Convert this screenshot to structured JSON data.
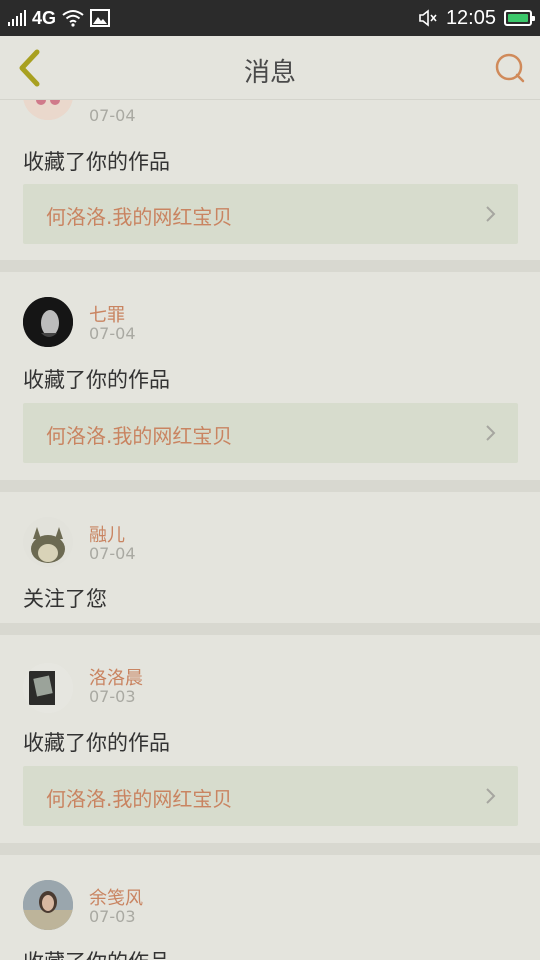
{
  "status_bar": {
    "network": "4G",
    "time": "12:05"
  },
  "header": {
    "title": "消息",
    "back_icon": "chevron-left-icon",
    "search_icon": "search-icon"
  },
  "colors": {
    "accent": "#c98461",
    "back_arrow": "#a8a020",
    "battery": "#3cc86b"
  },
  "messages": [
    {
      "user": "",
      "date": "07-04",
      "action": "收藏了你的作品",
      "work": "何洛洛.我的网红宝贝"
    },
    {
      "user": "七罪",
      "date": "07-04",
      "action": "收藏了你的作品",
      "work": "何洛洛.我的网红宝贝"
    },
    {
      "user": "融儿",
      "date": "07-04",
      "action": "关注了您",
      "work": ""
    },
    {
      "user": "洛洛晨",
      "date": "07-03",
      "action": "收藏了你的作品",
      "work": "何洛洛.我的网红宝贝"
    },
    {
      "user": "余笺风",
      "date": "07-03",
      "action": "收藏了你的作品",
      "work": ""
    }
  ]
}
